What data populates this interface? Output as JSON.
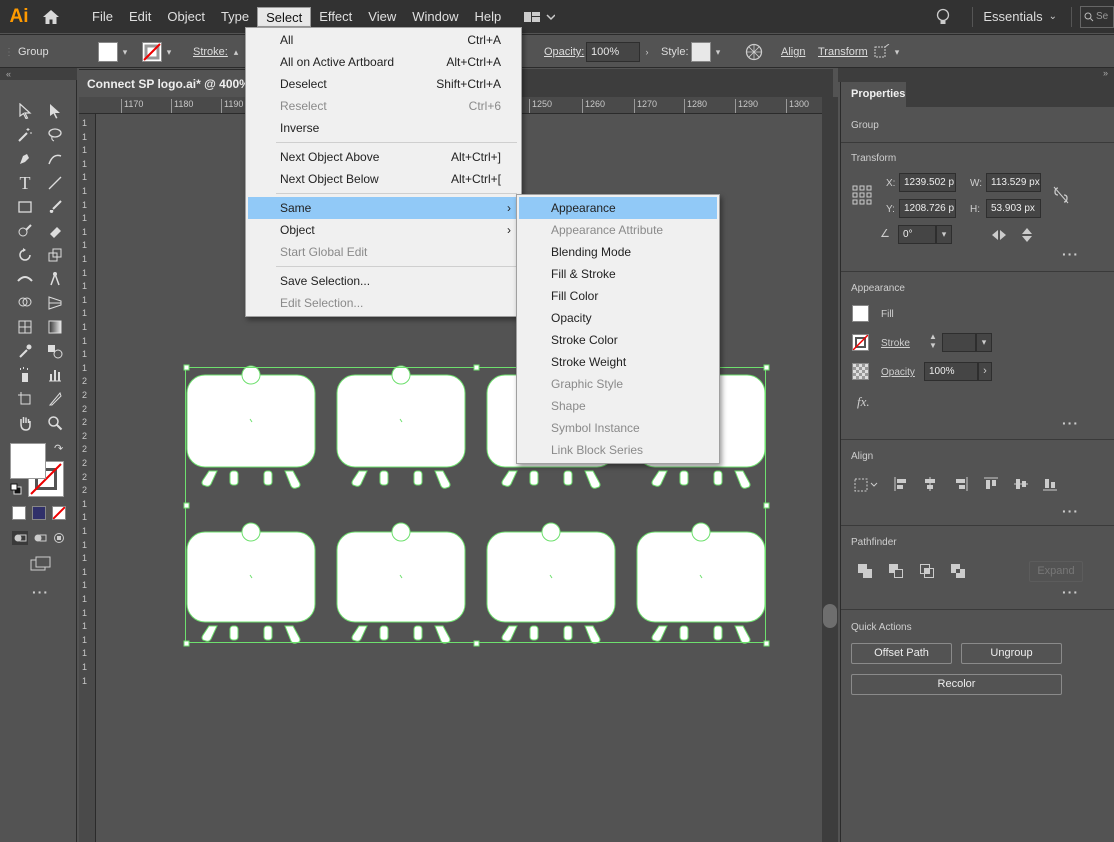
{
  "app": {
    "logo": "Ai"
  },
  "menubar": {
    "items": [
      "File",
      "Edit",
      "Object",
      "Type",
      "Select",
      "Effect",
      "View",
      "Window",
      "Help"
    ],
    "workspace": "Essentials",
    "search_placeholder": "Se"
  },
  "controlbar": {
    "group_label": "Group",
    "stroke_label": "Stroke:",
    "opacity_label": "Opacity:",
    "opacity_value": "100%",
    "style_label": "Style:",
    "align_label": "Align",
    "transform_label": "Transform"
  },
  "document": {
    "tab_title": "Connect SP logo.ai* @ 400% (R"
  },
  "ruler": {
    "top": [
      "1170",
      "1180",
      "1190",
      "1250",
      "1260",
      "1270",
      "1280",
      "1290",
      "1300"
    ],
    "left": [
      "1",
      "1",
      "1",
      "1",
      "1",
      "1",
      "1",
      "1",
      "1",
      "1",
      "1",
      "1",
      "1",
      "1",
      "1",
      "1",
      "1",
      "1",
      "1",
      "2",
      "2",
      "2",
      "2",
      "2",
      "2",
      "2",
      "2",
      "2",
      "1",
      "1",
      "1",
      "1",
      "1",
      "1",
      "1",
      "1",
      "1",
      "1",
      "1",
      "1",
      "1",
      "1"
    ]
  },
  "select_menu": {
    "items": [
      {
        "label": "All",
        "shortcut": "Ctrl+A",
        "disabled": false
      },
      {
        "label": "All on Active Artboard",
        "shortcut": "Alt+Ctrl+A",
        "disabled": false
      },
      {
        "label": "Deselect",
        "shortcut": "Shift+Ctrl+A",
        "disabled": false
      },
      {
        "label": "Reselect",
        "shortcut": "Ctrl+6",
        "disabled": true
      },
      {
        "label": "Inverse",
        "shortcut": "",
        "disabled": false
      },
      {
        "label": "Next Object Above",
        "shortcut": "Alt+Ctrl+]",
        "disabled": false
      },
      {
        "label": "Next Object Below",
        "shortcut": "Alt+Ctrl+[",
        "disabled": false
      },
      {
        "label": "Same",
        "shortcut": "",
        "disabled": false
      },
      {
        "label": "Object",
        "shortcut": "",
        "disabled": false
      },
      {
        "label": "Start Global Edit",
        "shortcut": "",
        "disabled": true
      },
      {
        "label": "Save Selection...",
        "shortcut": "",
        "disabled": false
      },
      {
        "label": "Edit Selection...",
        "shortcut": "",
        "disabled": true
      }
    ]
  },
  "same_menu": {
    "items": [
      {
        "label": "Appearance",
        "disabled": false
      },
      {
        "label": "Appearance Attribute",
        "disabled": true
      },
      {
        "label": "Blending Mode",
        "disabled": false
      },
      {
        "label": "Fill & Stroke",
        "disabled": false
      },
      {
        "label": "Fill Color",
        "disabled": false
      },
      {
        "label": "Opacity",
        "disabled": false
      },
      {
        "label": "Stroke Color",
        "disabled": false
      },
      {
        "label": "Stroke Weight",
        "disabled": false
      },
      {
        "label": "Graphic Style",
        "disabled": true
      },
      {
        "label": "Shape",
        "disabled": true
      },
      {
        "label": "Symbol Instance",
        "disabled": true
      },
      {
        "label": "Link Block Series",
        "disabled": true
      }
    ]
  },
  "properties": {
    "tab": "Properties",
    "selection_type": "Group",
    "transform": {
      "title": "Transform",
      "x_label": "X:",
      "x_value": "1239.502 p",
      "y_label": "Y:",
      "y_value": "1208.726 p",
      "w_label": "W:",
      "w_value": "113.529 px",
      "h_label": "H:",
      "h_value": "53.903 px",
      "angle_value": "0°"
    },
    "appearance": {
      "title": "Appearance",
      "fill_label": "Fill",
      "stroke_label": "Stroke",
      "opacity_label": "Opacity",
      "opacity_value": "100%",
      "fx_label": "fx."
    },
    "align": {
      "title": "Align"
    },
    "pathfinder": {
      "title": "Pathfinder",
      "expand_label": "Expand"
    },
    "quick_actions": {
      "title": "Quick Actions",
      "offset_path": "Offset Path",
      "ungroup": "Ungroup",
      "recolor": "Recolor"
    }
  },
  "colors": {
    "selection": "#6ee06e",
    "accent_highlight": "#91c9f7",
    "logo": "#ff9a00"
  }
}
